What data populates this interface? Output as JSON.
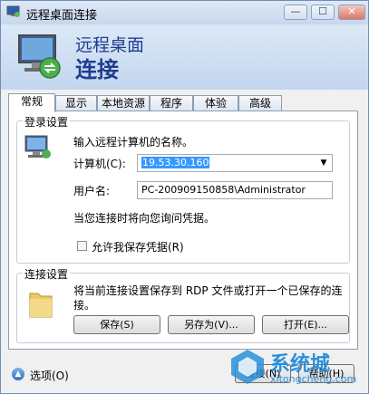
{
  "window": {
    "title": "远程桌面连接",
    "min_label": "—",
    "max_label": "☐",
    "close_label": "✕"
  },
  "header": {
    "line1": "远程桌面",
    "line2": "连接"
  },
  "tabs": [
    {
      "label": "常规",
      "active": true
    },
    {
      "label": "显示"
    },
    {
      "label": "本地资源"
    },
    {
      "label": "程序"
    },
    {
      "label": "体验"
    },
    {
      "label": "高级"
    }
  ],
  "login": {
    "legend": "登录设置",
    "prompt": "输入远程计算机的名称。",
    "computer_label": "计算机(C):",
    "computer_value": "19.53.30.160",
    "username_label": "用户名:",
    "username_value": "PC-200909150858\\Administrator",
    "info": "当您连接时将向您询问凭据。",
    "save_credentials_label": "允许我保存凭据(R)",
    "save_credentials_checked": false
  },
  "connection": {
    "legend": "连接设置",
    "desc_line1": "将当前连接设置保存到 RDP 文件或打开一个已保存的连",
    "desc_line2": "接。",
    "save_label": "保存(S)",
    "save_as_label": "另存为(V)...",
    "open_label": "打开(E)..."
  },
  "footer": {
    "options_label": "选项(O)",
    "connect_label": "连接(N)",
    "help_label": "帮助(H)"
  },
  "watermark": {
    "brand": "系统城",
    "url": "xitongcheng.com"
  }
}
